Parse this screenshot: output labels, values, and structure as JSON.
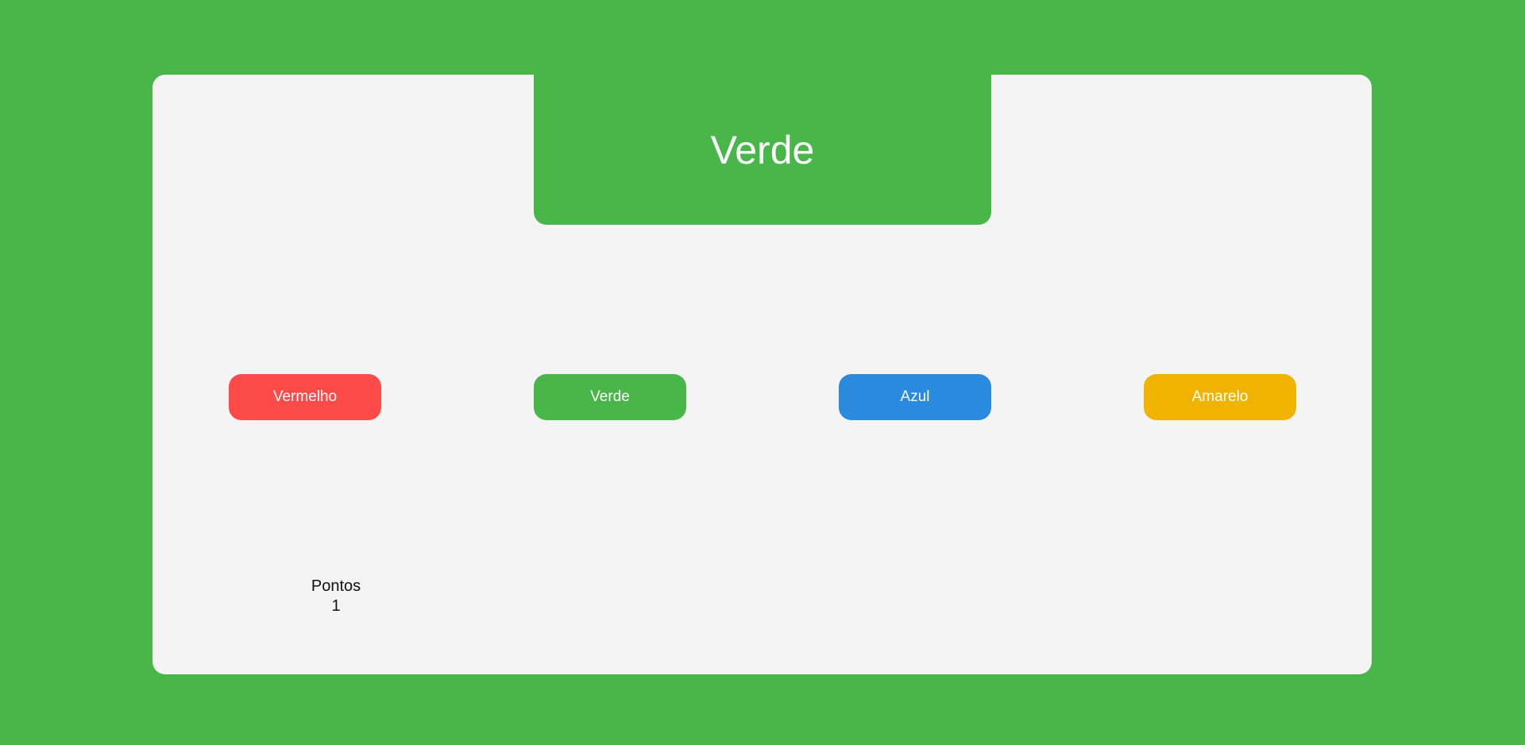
{
  "colors": {
    "background": "#49b649",
    "card": "#f4f4f4",
    "red": "#ff4a4a",
    "green": "#49b649",
    "blue": "#2a8ade",
    "yellow": "#f0b400"
  },
  "display": {
    "word": "Verde",
    "color": "#49b649"
  },
  "buttons": [
    {
      "label": "Vermelho",
      "color": "#ff4a4a"
    },
    {
      "label": "Verde",
      "color": "#49b649"
    },
    {
      "label": "Azul",
      "color": "#2a8ade"
    },
    {
      "label": "Amarelo",
      "color": "#f0b400"
    }
  ],
  "score": {
    "label": "Pontos",
    "value": "1"
  }
}
